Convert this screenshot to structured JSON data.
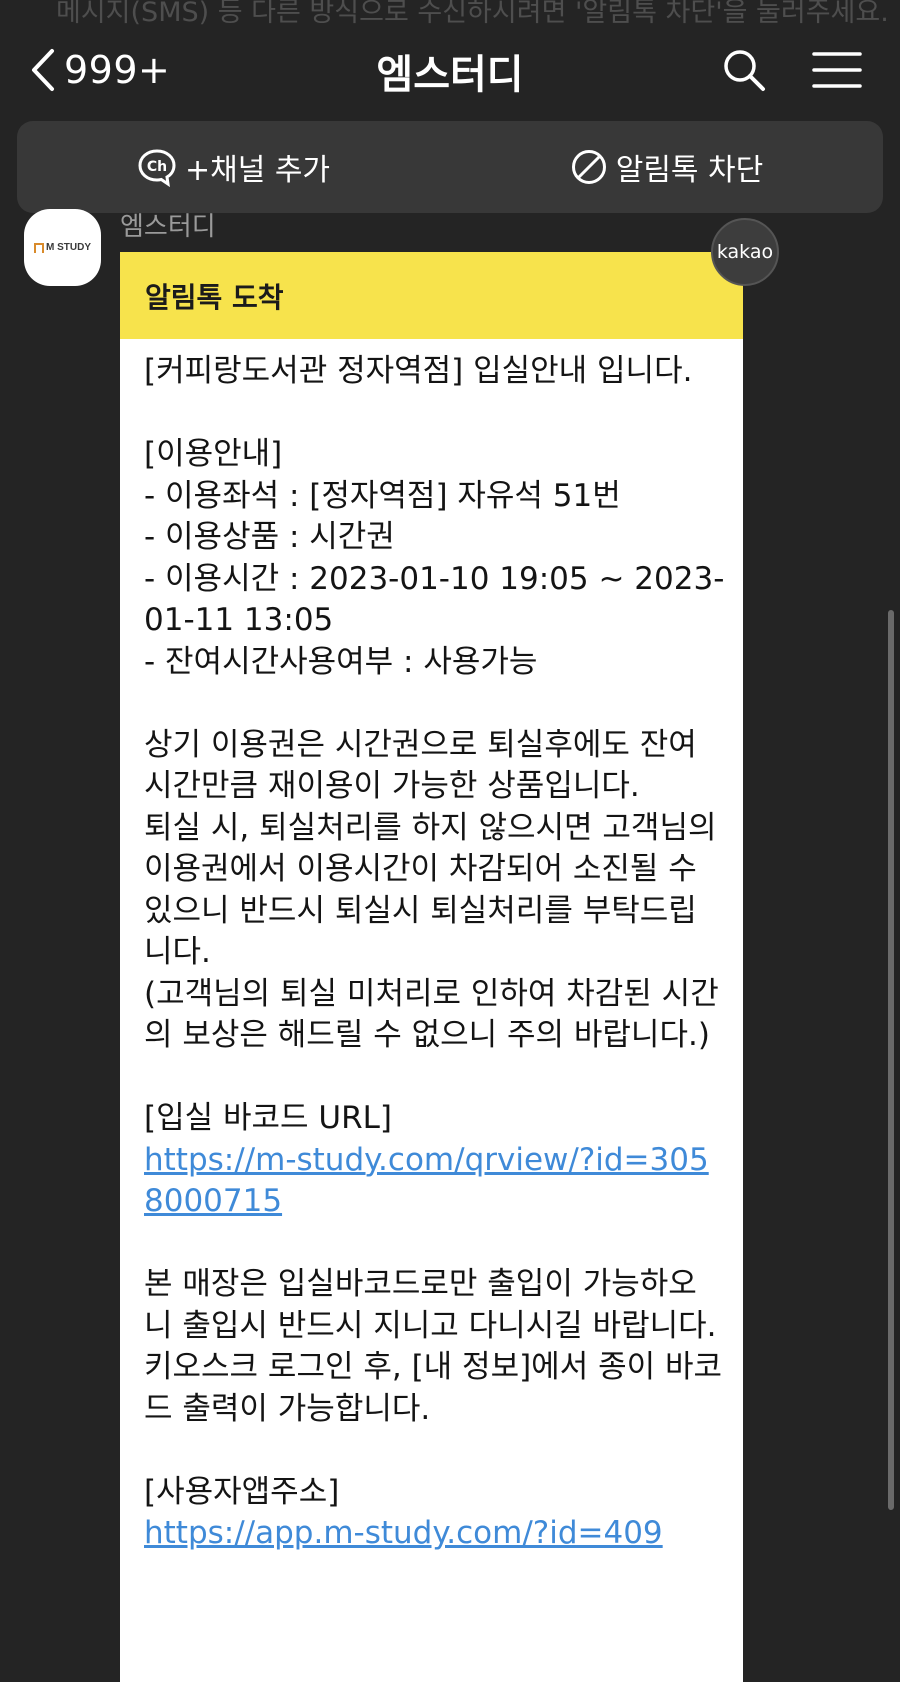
{
  "background_notice": "메시지(SMS) 등 다른 방식으로 수신하시려면 '알림톡 차단'을 눌러주세요.",
  "header": {
    "unread_count": "999+",
    "title": "엠스터디"
  },
  "channel_bar": {
    "add_channel_label": "+채널 추가",
    "block_label": "알림톡 차단"
  },
  "chat": {
    "sender_name": "엠스터디",
    "avatar_logo_text": "M STUDY",
    "badge_label": "kakao",
    "message": {
      "header_title": "알림톡 도착",
      "lines": [
        {
          "text": "[커피랑도서관 정자역점] 입실안내 입니다."
        },
        {
          "text": ""
        },
        {
          "text": "[이용안내]"
        },
        {
          "text": "- 이용좌석 : [정자역점] 자유석 51번"
        },
        {
          "text": "- 이용상품 : 시간권"
        },
        {
          "text": "- 이용시간 : 2023-01-10 19:05 ~ 2023-01-11 13:05"
        },
        {
          "text": "- 잔여시간사용여부 : 사용가능"
        },
        {
          "text": ""
        },
        {
          "text": "상기 이용권은 시간권으로 퇴실후에도 잔여시간만큼 재이용이 가능한 상품입니다."
        },
        {
          "text": "퇴실 시, 퇴실처리를 하지 않으시면 고객님의 이용권에서 이용시간이 차감되어 소진될 수 있으니 반드시 퇴실시 퇴실처리를 부탁드립니다."
        },
        {
          "text": "(고객님의 퇴실 미처리로 인하여 차감된 시간의 보상은 해드릴 수 없으니 주의 바랍니다.)"
        },
        {
          "text": ""
        },
        {
          "text": "[입실 바코드 URL]"
        },
        {
          "text": "https://m-study.com/qrview/?id=3058000715",
          "link": true
        },
        {
          "text": ""
        },
        {
          "text": "본 매장은 입실바코드로만 출입이 가능하오니 출입시 반드시 지니고 다니시길 바랍니다."
        },
        {
          "text": "키오스크 로그인 후, [내 정보]에서 종이 바코드 출력이 가능합니다."
        },
        {
          "text": ""
        },
        {
          "text": "[사용자앱주소]"
        },
        {
          "text": "https://app.m-study.com/?id=409",
          "link": true
        }
      ]
    }
  }
}
